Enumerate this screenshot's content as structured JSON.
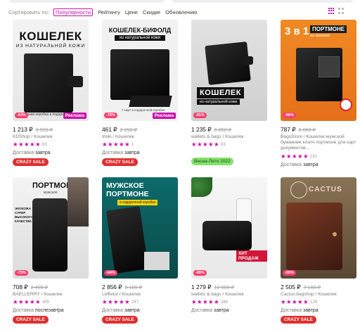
{
  "sort": {
    "label": "Сортировать по:",
    "options": [
      "Популярности",
      "Рейтингу",
      "Цене",
      "Скидке",
      "Обновлению"
    ],
    "active_index": 0
  },
  "colors": {
    "accent": "#cb11ab",
    "sale": "#f43f6e",
    "crazy": "#e02e2e",
    "promo": "#82e36c"
  },
  "products": [
    {
      "img_title": "КОШЕЛЕК",
      "img_sub": "из натуральной кожи",
      "img_note": "Черная коробка в подарок",
      "discount": "-63%",
      "ad": "Реклама",
      "price": "1 213 ₽",
      "old_price": "3 999 ₽",
      "brand": "KDShop / Кошелек",
      "rating_count": "83",
      "delivery_label": "Доставка",
      "delivery_day": "завтра",
      "badge": "CRAZY SALE"
    },
    {
      "img_title": "КОШЕЛЕК-БИФОЛД",
      "img_sub": "из натуральной кожи",
      "img_note": "7 карт в подарочной коробке",
      "discount": "-79%",
      "ad": "Реклама",
      "price": "461 ₽",
      "old_price": "2 250 ₽",
      "brand": "Imiki / Кошелек",
      "rating_count": "1",
      "delivery_label": "Доставка",
      "delivery_day": "завтра",
      "badge": "CRAZY SALE"
    },
    {
      "img_title": "КОШЕЛЕК",
      "img_sub": "из натуральной кожи",
      "discount": "-81%",
      "price": "1 235 ₽",
      "old_price": "6 850 ₽",
      "brand": "wallets & bags / Кошелек",
      "rating_count": "83",
      "badge": "Весна-Лето 2022"
    },
    {
      "img_title": "3 в 1",
      "img_sub": "ПОРТМОНЕ",
      "img_note": "из экокожи",
      "discount": "-86%",
      "price": "787 ₽",
      "old_price": "6 000 ₽",
      "brand": "BagsStore / Кошелек мужской бумажник клатч портмоне для карт документов...",
      "rating_count": "181",
      "delivery_label": "Доставка",
      "delivery_day": "завтра"
    },
    {
      "img_title": "ПОРТМОНЕ",
      "img_sub": "мужское",
      "img_side": "ЭКОКОЖА СУПЕР ВЫСОКОГО КАЧЕСТВА",
      "discount": "-75%",
      "price": "708 ₽",
      "old_price": "2 400 ₽",
      "brand": "BAELLERRY / Кошелек",
      "rating_count": "495",
      "delivery_label": "Доставка",
      "delivery_day": "послезавтра",
      "badge": "CRAZY SALE"
    },
    {
      "img_title": "МУЖСКОЕ ПОРТМОНЕ",
      "img_sub": "в подарочной коробке",
      "discount": "-64%",
      "price": "2 856 ₽",
      "old_price": "8 100 ₽",
      "brand": "Leffeluv / Кошелек",
      "rating_count": "247",
      "delivery_label": "Доставка",
      "delivery_day": "завтра",
      "badge": "CRAZY SALE"
    },
    {
      "img_title": "ХИТ ПРОДАЖ",
      "discount": "-89%",
      "price": "1 279 ₽",
      "old_price": "12 000 ₽",
      "brand": "wallets & bags / Кошелек",
      "rating_count": "386",
      "delivery_label": "Доставка",
      "delivery_day": "завтра"
    },
    {
      "img_title": "CACTUS",
      "discount": "-65%",
      "price": "2 505 ₽",
      "old_price": "7 168 ₽",
      "brand": "Cactus.bagshop / Кошелек",
      "rating_count": "128",
      "delivery_label": "Доставка",
      "delivery_day": "завтра",
      "badge": "CRAZY SALE"
    }
  ]
}
